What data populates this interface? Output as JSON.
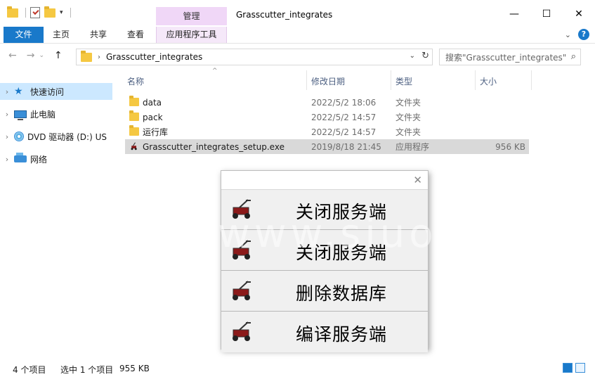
{
  "window": {
    "title": "Grasscutter_integrates",
    "context_group": "管理",
    "controls": {
      "minimize": "—",
      "maximize": "☐",
      "close": "✕"
    }
  },
  "ribbon": {
    "tabs": [
      "文件",
      "主页",
      "共享",
      "查看",
      "应用程序工具"
    ],
    "expand_icon": "chevron-down-icon",
    "help_label": "?"
  },
  "address": {
    "path": "Grasscutter_integrates",
    "search_placeholder": "搜索\"Grasscutter_integrates\""
  },
  "navpane": {
    "items": [
      {
        "label": "快速访问",
        "icon": "star-icon"
      },
      {
        "label": "此电脑",
        "icon": "computer-icon"
      },
      {
        "label": "DVD 驱动器 (D:) US",
        "icon": "dvd-icon"
      },
      {
        "label": "网络",
        "icon": "network-icon"
      }
    ]
  },
  "filelist": {
    "columns": [
      "名称",
      "修改日期",
      "类型",
      "大小"
    ],
    "rows": [
      {
        "name": "data",
        "date": "2022/5/2 18:06",
        "type": "文件夹",
        "size": ""
      },
      {
        "name": "pack",
        "date": "2022/5/2 14:57",
        "type": "文件夹",
        "size": ""
      },
      {
        "name": "运行库",
        "date": "2022/5/2 14:57",
        "type": "文件夹",
        "size": ""
      },
      {
        "name": "Grasscutter_integrates_setup.exe",
        "date": "2019/8/18 21:45",
        "type": "应用程序",
        "size": "956 KB"
      }
    ]
  },
  "dialog": {
    "close": "✕",
    "buttons": [
      "关闭服务端",
      "关闭服务端",
      "删除数据库",
      "编译服务端"
    ]
  },
  "watermark": "www.siuo.cc",
  "status": {
    "item_count": "4 个项目",
    "selection": "选中 1 个项目",
    "selection_size": "955 KB"
  }
}
